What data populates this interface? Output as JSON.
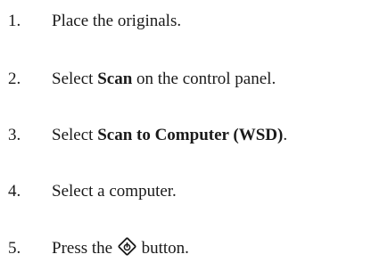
{
  "steps": [
    {
      "number": "1.",
      "text": "Place the originals."
    },
    {
      "number": "2.",
      "before": "Select ",
      "bold": "Scan",
      "after": " on the control panel."
    },
    {
      "number": "3.",
      "before": "Select ",
      "bold": "Scan to Computer (WSD)",
      "after": "."
    },
    {
      "number": "4.",
      "text": "Select a computer."
    },
    {
      "number": "5.",
      "before": "Press the ",
      "icon": "start-button-icon",
      "after": " button."
    }
  ]
}
